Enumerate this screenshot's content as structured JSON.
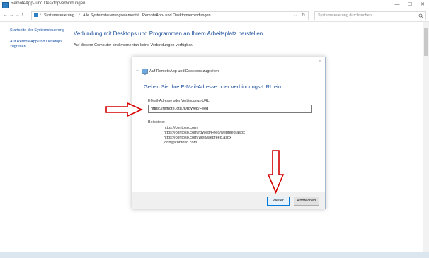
{
  "window": {
    "title": "RemoteApp- und Desktopverbindungen",
    "controls": {
      "minimize": "—",
      "maximize": "☐",
      "close": "✕"
    }
  },
  "addressbar": {
    "back": "←",
    "forward": "→",
    "recent": "⌄",
    "up": "↑",
    "breadcrumbs": [
      "Systemsteuerung",
      "Alle Systemsteuerungselemente",
      "RemoteApp- und Desktopverbindungen"
    ],
    "separator": "›",
    "dropdown": "⌄",
    "refresh": "↻",
    "search_placeholder": "Systemsteuerung durchsuchen"
  },
  "sidebar": {
    "items": [
      {
        "label": "Startseite der Systemsteuerung"
      },
      {
        "label": "Auf RemoteApp und Desktops zugreifen"
      }
    ]
  },
  "main": {
    "title": "Verbindung mit Desktops und Programmen an Ihrem Arbeitsplatz herstellen",
    "text": "Auf diesem Computer sind momentan keine Verbindungen verfügbar."
  },
  "dialog": {
    "title": "Auf RemoteApp und Desktops zugreifen",
    "close": "✕",
    "back": "←",
    "heading": "Geben Sie Ihre E-Mail-Adresse oder Verbindungs-URL ein",
    "field_label": "E-Mail-Adresse oder Verbindungs-URL:",
    "field_value": "https://remote.ictu.nl/rdWeb/Feed",
    "examples_title": "Beispiele:",
    "examples": [
      "https://contoso.com",
      "https://contoso.com/rdWeb/Feed/webfeed.aspx",
      "https://contoso.com/Web/webfeed.aspx",
      "john@contoso.com"
    ],
    "next_label": "Weiter",
    "cancel_label": "Abbrechen"
  },
  "colors": {
    "accent": "#1c4f9c",
    "annotation": "#d40000",
    "link": "#1f56a8"
  }
}
